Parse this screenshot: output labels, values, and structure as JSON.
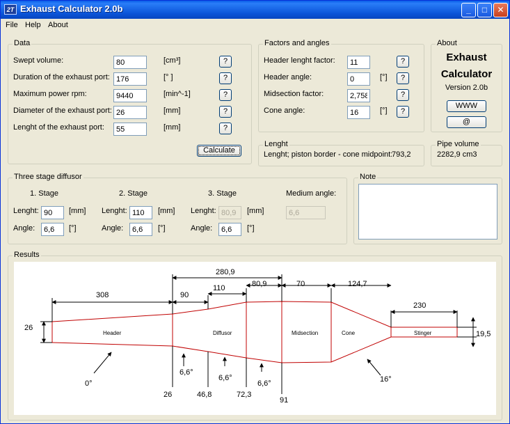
{
  "window": {
    "title": "Exhaust Calculator 2.0b",
    "icon_text": "2T"
  },
  "menu": [
    "File",
    "Help",
    "About"
  ],
  "data_group": {
    "label": "Data",
    "rows": [
      {
        "label": "Swept volume:",
        "value": "80",
        "unit": "[cm³]"
      },
      {
        "label": "Duration of the exhaust port:",
        "value": "176",
        "unit": "[° ]"
      },
      {
        "label": "Maximum power rpm:",
        "value": "9440",
        "unit": "[min^-1]"
      },
      {
        "label": "Diameter of the exhaust port:",
        "value": "26",
        "unit": "[mm]"
      },
      {
        "label": "Lenght of the exhaust port:",
        "value": "55",
        "unit": "[mm]"
      }
    ],
    "help_label": "?",
    "calculate_label": "Calculate"
  },
  "factors_group": {
    "label": "Factors and angles",
    "rows": [
      {
        "label": "Header lenght factor:",
        "value": "11",
        "unit": ""
      },
      {
        "label": "Header angle:",
        "value": "0",
        "unit": "[°]"
      },
      {
        "label": "Midsection factor:",
        "value": "2,758",
        "unit": ""
      },
      {
        "label": "Cone angle:",
        "value": "16",
        "unit": "[°]"
      }
    ]
  },
  "about_group": {
    "label": "About",
    "line1": "Exhaust",
    "line2": "Calculator",
    "version": "Version 2.0b",
    "www_label": "WWW",
    "email_label": "@"
  },
  "lenght_group": {
    "label": "Lenght",
    "text": "Lenght; piston border - cone midpoint:",
    "value": "793,2"
  },
  "pipe_volume_group": {
    "label": "Pipe volume",
    "value": "2282,9 cm3"
  },
  "diffusor_group": {
    "label": "Three stage diffusor",
    "stages": [
      {
        "title": "1. Stage",
        "lenght_label": "Lenght:",
        "lenght": "90",
        "angle_label": "Angle:",
        "angle": "6,6",
        "lenght_unit": "[mm]",
        "angle_unit": "[°]"
      },
      {
        "title": "2. Stage",
        "lenght_label": "Lenght:",
        "lenght": "110",
        "angle_label": "Angle:",
        "angle": "6,6",
        "lenght_unit": "[mm]",
        "angle_unit": "[°]"
      },
      {
        "title": "3. Stage",
        "lenght_label": "Lenght:",
        "lenght": "80,9",
        "angle_label": "Angle:",
        "angle": "6,6",
        "lenght_unit": "[mm]",
        "angle_unit": "[°]"
      }
    ],
    "medium_angle_label": "Medium angle:",
    "medium_angle": "6,6"
  },
  "note_group": {
    "label": "Note",
    "text": ""
  },
  "results_group": {
    "label": "Results",
    "sections": {
      "header": "Header",
      "diffusor": "Diffusor",
      "midsection": "Midsection",
      "cone": "Cone",
      "stinger": "Stinger"
    },
    "dims": {
      "total_diffusor": "280,9",
      "header_len": "308",
      "stage1": "90",
      "stage2": "110",
      "stage3": "80,9",
      "midsection": "70",
      "cone": "124,7",
      "stinger": "230",
      "inlet_diameter": "26",
      "stinger_diameter": "19,5"
    },
    "diameters": {
      "d1": "26",
      "d2": "46,8",
      "d3": "72,3",
      "d4": "91"
    },
    "angles": {
      "header": "0°",
      "stage1": "6,6°",
      "stage2": "6,6°",
      "stage3": "6,6°",
      "cone": "16°"
    }
  }
}
